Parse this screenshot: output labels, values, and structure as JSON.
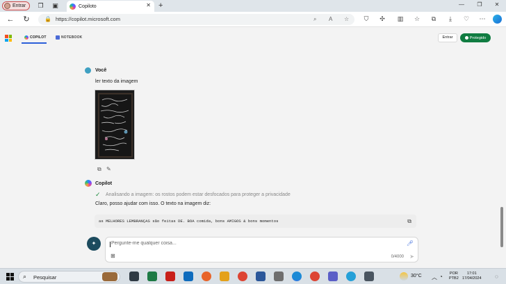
{
  "browser": {
    "profile_label": "Entrar",
    "tab_title": "Copiloto",
    "url": "https://copilot.microsoft.com"
  },
  "app": {
    "tabs": [
      {
        "label": "COPILOT",
        "active": true
      },
      {
        "label": "NOTEBOOK",
        "active": false
      }
    ],
    "signin_label": "Entrar",
    "protected_label": "Protegido"
  },
  "chat": {
    "user_name": "Você",
    "user_message": "ler texto da imagem",
    "bot_name": "Copilot",
    "analysis_status": "Analisando a imagem: os rostos podem estar desfocados para proteger a privacidade",
    "bot_reply": "Claro, posso ajudar com isso. O texto na imagem diz:",
    "extracted_text": "as MELHORES LEMBRANÇAS são feitas DE. BOA comida, bons AMIGOS & bons momentos"
  },
  "composer": {
    "placeholder": "Pergunte-me qualquer coisa...",
    "counter": "0/4000"
  },
  "taskbar": {
    "search_label": "Pesquisar",
    "temperature": "30°C",
    "lang_line1": "POR",
    "lang_line2": "PTB2",
    "time": "17:01",
    "date": "17/04/2024"
  },
  "colors": {
    "accent": "#2b5fd9",
    "protected_green": "#107c41"
  }
}
